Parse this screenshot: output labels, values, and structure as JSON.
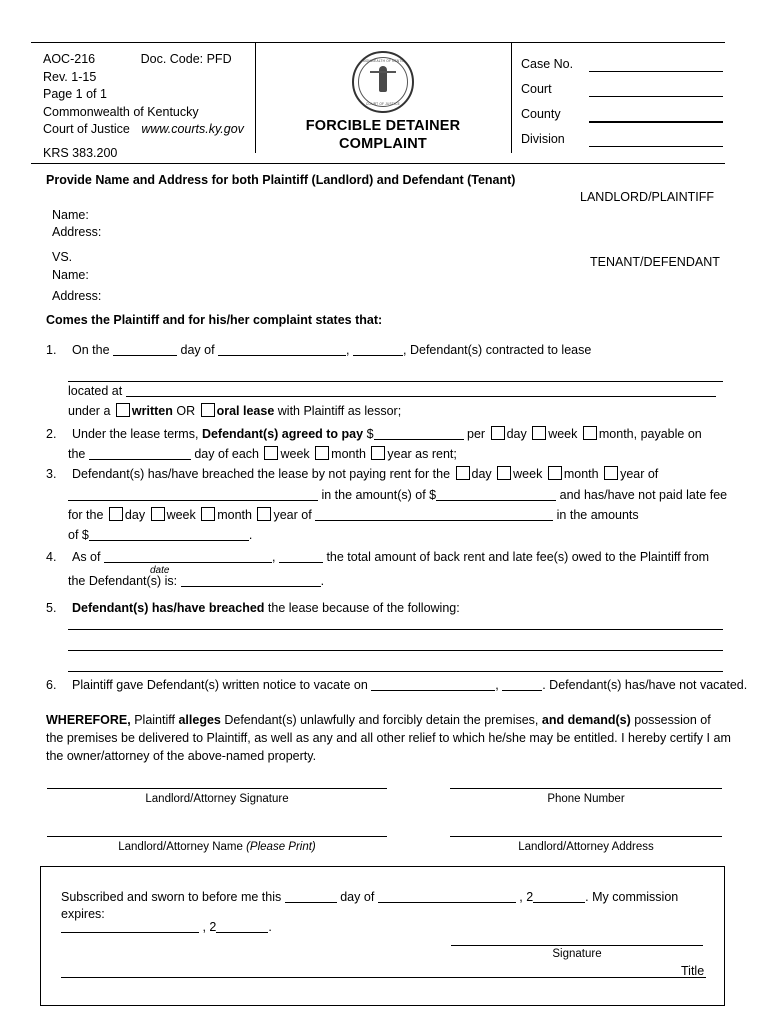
{
  "header": {
    "form_number": "AOC-216",
    "doc_code": "Doc. Code: PFD",
    "revision": "Rev. 1-15",
    "page": "Page 1 of 1",
    "commonwealth": "Commonwealth of Kentucky",
    "court_of_justice": "Court of Justice",
    "url": "www.courts.ky.gov",
    "krs": "KRS 383.200",
    "seal_top_text": "COMMONWEALTH OF KENTUCKY",
    "seal_bottom_text": "COURT OF JUSTICE",
    "title_line1": "FORCIBLE DETAINER",
    "title_line2": "COMPLAINT",
    "fields": [
      {
        "label": "Case  No.",
        "value": ""
      },
      {
        "label": "Court",
        "value": ""
      },
      {
        "label": "County",
        "value": ""
      },
      {
        "label": "Division",
        "value": ""
      }
    ]
  },
  "parties": {
    "instruction": "Provide Name and Address for both Plaintiff (Landlord) and Defendant (Tenant)",
    "landlord_heading": "LANDLORD/PLAINTIFF",
    "tenant_heading": "TENANT/DEFENDANT",
    "name_label": "Name:",
    "address_label": "Address:",
    "vs_label": "VS."
  },
  "intro": "Comes the Plaintiff and for his/her complaint states that:",
  "items": {
    "one": {
      "number": "1.",
      "t1": "On the",
      "t2": "day of",
      "t3": ",",
      "t4": ", Defendant(s) contracted to lease",
      "located_at": "located at",
      "under_a": "under a",
      "written": "written",
      "or": "OR",
      "oral_lease": "oral lease",
      "with_lessor": "with Plaintiff as lessor;"
    },
    "two": {
      "number": "2.",
      "t1": "Under the lease terms,",
      "bold1": "Defendant(s) agreed to pay",
      "dollar": "$",
      "per": "per",
      "day": "day",
      "week": "week",
      "month": "month",
      "payable_on": ", payable on",
      "the": "the",
      "day_of_each": "day of each",
      "year_as_rent": "year as rent;"
    },
    "three": {
      "number": "3.",
      "t1": "Defendant(s) has/have breached the lease by not paying rent for the",
      "day": "day",
      "week": "week",
      "month": "month",
      "year_of": "year of",
      "in_the_amounts_of": "in the amount(s) of $",
      "late_fee": "and has/have not paid late fee",
      "for_the": "for the",
      "in_the_amounts": "in the amounts",
      "of_dollar": "of $"
    },
    "four": {
      "number": "4.",
      "as_of": "As of",
      "date_caption": "date",
      "comma": ",",
      "t2": "the total amount of back rent and late fee(s) owed to the Plaintiff from",
      "t3": "the Defendant(s) is:",
      "period": "."
    },
    "five": {
      "number": "5.",
      "bold": "Defendant(s) has/have breached",
      "rest": "the lease because of the following:"
    },
    "six": {
      "number": "6.",
      "t1": "Plaintiff gave Defendant(s) written notice to vacate on",
      "comma": ",",
      "t2": ". Defendant(s) has/have not vacated."
    }
  },
  "wherefore": {
    "bold1": "WHEREFORE,",
    "t1": "Plaintiff",
    "bold2": "alleges",
    "t2": "Defendant(s) unlawfully and forcibly detain the premises,",
    "bold3": "and demand(s)",
    "t3": "possession of",
    "line2": "the premises be delivered to Plaintiff, as well as any and all other relief to which he/she may be entitled.  I hereby certify",
    "line3": "I am the owner/attorney of the above-named property."
  },
  "signatures": {
    "landlord_signature": "Landlord/Attorney Signature",
    "phone_number": "Phone Number",
    "landlord_name": "Landlord/Attorney Name",
    "landlord_name_italic": "(Please Print)",
    "landlord_address": "Landlord/Attorney Address"
  },
  "notary": {
    "l1a": "Subscribed and sworn to before me this",
    "l1b": "day of",
    "l1c": ", 2",
    "l1d": ". My commission expires:",
    "l2a": ", 2",
    "l2b": ".",
    "signature_label": "Signature",
    "title_label": "Title"
  }
}
